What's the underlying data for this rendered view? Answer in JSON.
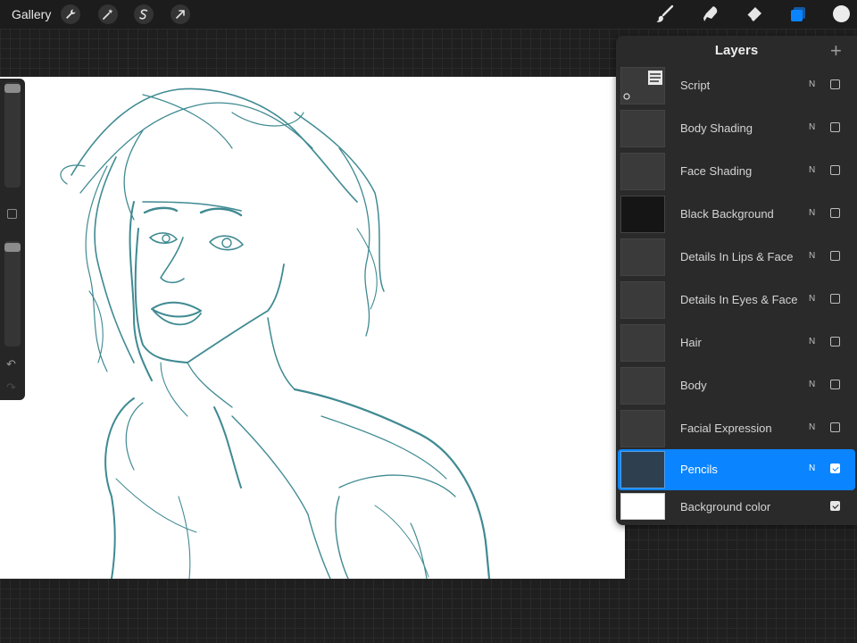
{
  "topbar": {
    "gallery_label": "Gallery",
    "left_tools": [
      "wrench-icon",
      "magic-wand-icon",
      "selection-icon",
      "transform-arrow-icon"
    ],
    "right_tools": [
      "brush-icon",
      "smudge-icon",
      "eraser-icon",
      "layers-icon"
    ],
    "active_tool": "layers-icon",
    "accent_color": "#0a84ff",
    "current_color": "#ececec"
  },
  "sidebar": {
    "undo_icon": "undo-icon",
    "redo_icon": "redo-icon",
    "undo_glyph": "↶",
    "redo_glyph": "↷"
  },
  "layers": {
    "title": "Layers",
    "add_glyph": "+",
    "items": [
      {
        "name": "Script",
        "blend": "N",
        "visible": false,
        "selected": false
      },
      {
        "name": "Body Shading",
        "blend": "N",
        "visible": false,
        "selected": false
      },
      {
        "name": "Face Shading",
        "blend": "N",
        "visible": false,
        "selected": false
      },
      {
        "name": "Black Background",
        "blend": "N",
        "visible": false,
        "selected": false
      },
      {
        "name": "Details In Lips & Face",
        "blend": "N",
        "visible": false,
        "selected": false
      },
      {
        "name": "Details In Eyes & Face",
        "blend": "N",
        "visible": false,
        "selected": false
      },
      {
        "name": "Hair",
        "blend": "N",
        "visible": false,
        "selected": false
      },
      {
        "name": "Body",
        "blend": "N",
        "visible": false,
        "selected": false
      },
      {
        "name": "Facial Expression",
        "blend": "N",
        "visible": false,
        "selected": false
      },
      {
        "name": "Pencils",
        "blend": "N",
        "visible": true,
        "selected": true
      },
      {
        "name": "Background color",
        "blend": "",
        "visible": true,
        "selected": false
      }
    ]
  }
}
